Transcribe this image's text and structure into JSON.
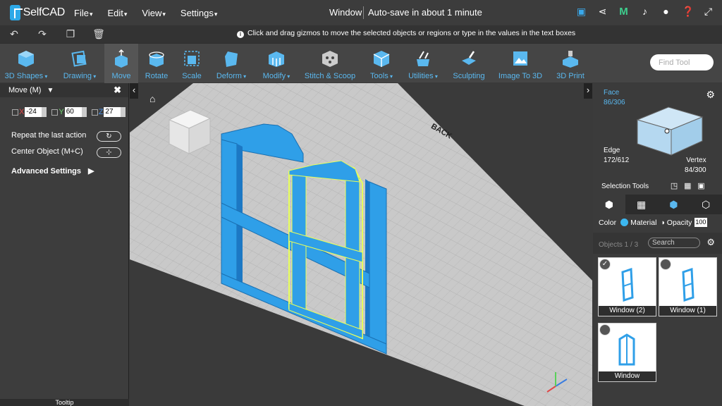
{
  "app": {
    "name": "SelfCAD",
    "window_title": "Window",
    "autosave": "Auto-save in about 1 minute"
  },
  "menu": [
    "File",
    "Edit",
    "View",
    "Settings"
  ],
  "hint": "Click and drag gizmos to move the selected objects or regions or type in the values in the text boxes",
  "tools": [
    {
      "label": "3D Shapes",
      "dropdown": true
    },
    {
      "label": "Drawing",
      "dropdown": true
    },
    {
      "label": "Move",
      "dropdown": false
    },
    {
      "label": "Rotate",
      "dropdown": false
    },
    {
      "label": "Scale",
      "dropdown": false
    },
    {
      "label": "Deform",
      "dropdown": true
    },
    {
      "label": "Modify",
      "dropdown": true
    },
    {
      "label": "Stitch & Scoop",
      "dropdown": false
    },
    {
      "label": "Tools",
      "dropdown": true
    },
    {
      "label": "Utilities",
      "dropdown": true
    },
    {
      "label": "Sculpting",
      "dropdown": false
    },
    {
      "label": "Image To 3D",
      "dropdown": false
    },
    {
      "label": "3D Print",
      "dropdown": false
    }
  ],
  "find_tool_placeholder": "Find Tool",
  "left_panel": {
    "title": "Move (M)",
    "x_label": "X",
    "x": "-24",
    "y_label": "Y",
    "y": "60",
    "z_label": "Z",
    "z": "27",
    "repeat": "Repeat the last action",
    "center": "Center Object (M+C)",
    "advanced": "Advanced Settings",
    "tooltip": "Tooltip"
  },
  "viewport": {
    "back_label": "BACK"
  },
  "right_panel": {
    "face_label": "Face",
    "face_count": "86/306",
    "edge_label": "Edge",
    "edge_count": "172/612",
    "vertex_label": "Vertex",
    "vertex_count": "84/300",
    "selection_tools": "Selection Tools",
    "color_label": "Color",
    "material_label": "Material",
    "opacity_label": "Opacity",
    "opacity": "100",
    "objects_count": "Objects 1 / 3",
    "search_placeholder": "Search",
    "objects": [
      {
        "name": "Window (2)",
        "checked": true
      },
      {
        "name": "Window (1)",
        "checked": false
      },
      {
        "name": "Window",
        "checked": false
      }
    ]
  },
  "colors": {
    "accent": "#3aa8ea",
    "object_blue": "#2f9fe8",
    "selected_edge": "#e8ff5a",
    "grid": "#c8c8c8"
  }
}
